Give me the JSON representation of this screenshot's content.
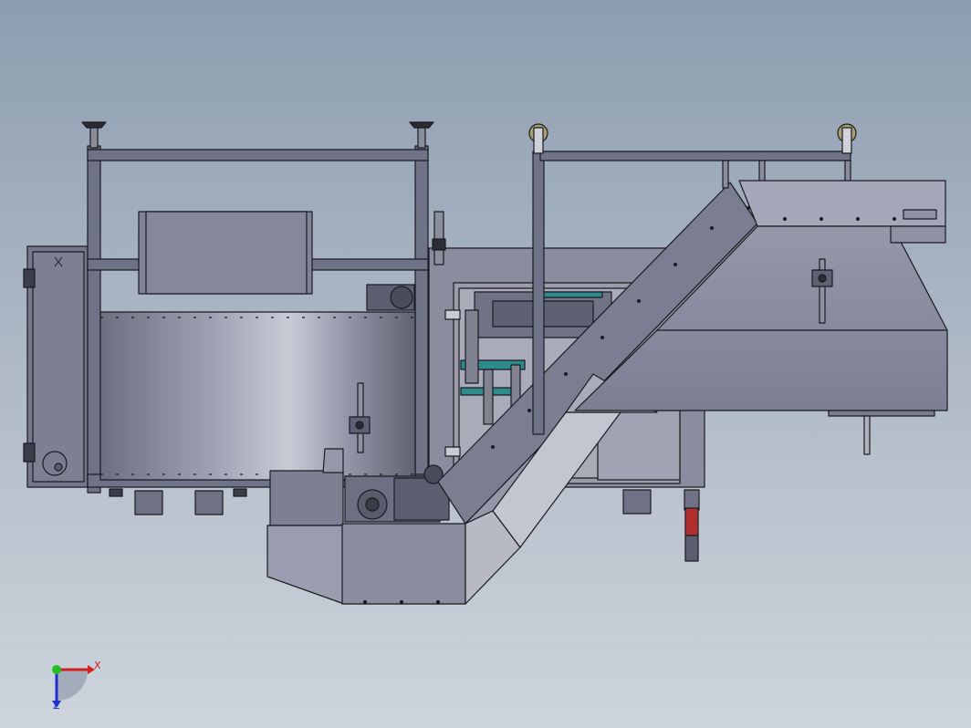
{
  "viewport": {
    "background_top": "#8d9db0",
    "background_bottom": "#cdd4dc",
    "model": {
      "description_icon": "machine-assembly-icon",
      "steel_color": "#7c7f92",
      "frame_color": "#6d7186",
      "sheet_metal_color": "#9fa2b4",
      "edge_color": "#1a1b22"
    },
    "triad": {
      "x_label": "X",
      "z_label": "Z",
      "x_color": "#d42020",
      "y_color": "#20c020",
      "z_color": "#2030d0"
    }
  }
}
